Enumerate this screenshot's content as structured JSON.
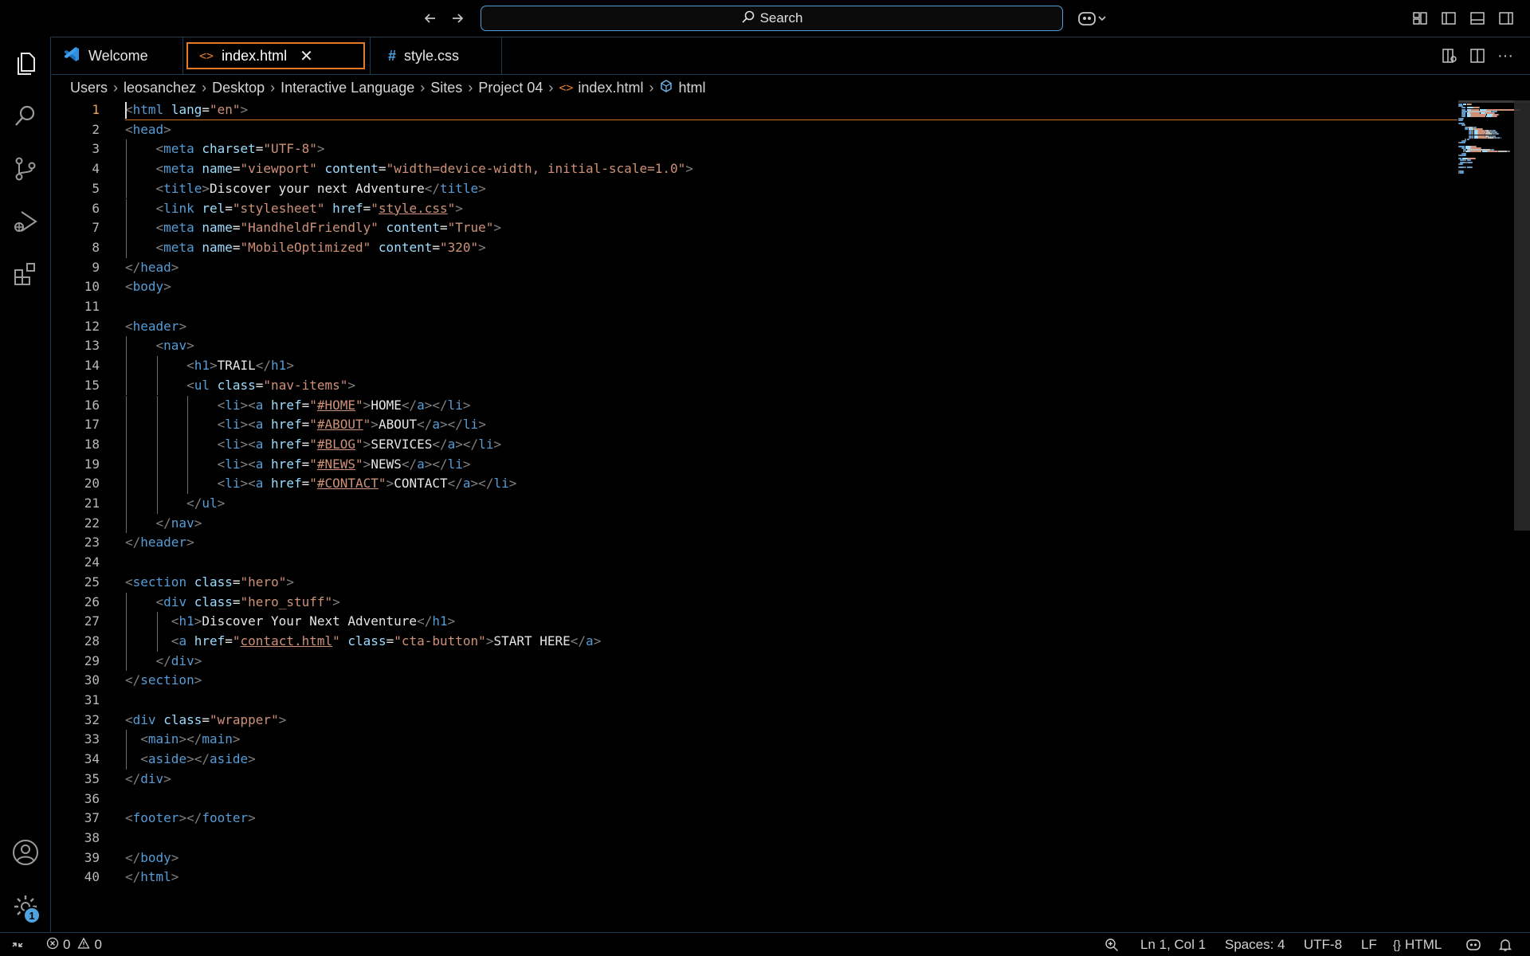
{
  "titlebar": {
    "search_label": "Search",
    "back_icon": "arrow-left-icon",
    "forward_icon": "arrow-right-icon"
  },
  "activity_bar": {
    "items": [
      "explorer",
      "search",
      "source-control",
      "run-and-debug",
      "extensions"
    ],
    "bottom": [
      "accounts",
      "manage"
    ],
    "manage_badge": "1"
  },
  "tabs": [
    {
      "label": "Welcome",
      "icon": "vscode-logo-icon",
      "active": false
    },
    {
      "label": "index.html",
      "icon": "html-file-icon",
      "active": true
    },
    {
      "label": "style.css",
      "icon": "css-file-icon",
      "active": false
    }
  ],
  "breadcrumb": [
    "Users",
    "leosanchez",
    "Desktop",
    "Interactive Language",
    "Sites",
    "Project 04",
    "index.html",
    "html"
  ],
  "editor": {
    "current_line": 1,
    "lines": [
      [
        [
          "br",
          "<"
        ],
        [
          "tag",
          "html"
        ],
        [
          "t",
          " "
        ],
        [
          "attr",
          "lang"
        ],
        [
          "t",
          "="
        ],
        [
          "str",
          "\"en\""
        ],
        [
          "br",
          ">"
        ]
      ],
      [
        [
          "br",
          "<"
        ],
        [
          "tag",
          "head"
        ],
        [
          "br",
          ">"
        ]
      ],
      [
        [
          "t",
          "    "
        ],
        [
          "br",
          "<"
        ],
        [
          "tag",
          "meta"
        ],
        [
          "t",
          " "
        ],
        [
          "attr",
          "charset"
        ],
        [
          "t",
          "="
        ],
        [
          "str",
          "\"UTF-8\""
        ],
        [
          "br",
          ">"
        ]
      ],
      [
        [
          "t",
          "    "
        ],
        [
          "br",
          "<"
        ],
        [
          "tag",
          "meta"
        ],
        [
          "t",
          " "
        ],
        [
          "attr",
          "name"
        ],
        [
          "t",
          "="
        ],
        [
          "str",
          "\"viewport\""
        ],
        [
          "t",
          " "
        ],
        [
          "attr",
          "content"
        ],
        [
          "t",
          "="
        ],
        [
          "str",
          "\"width=device-width, initial-scale=1.0\""
        ],
        [
          "br",
          ">"
        ]
      ],
      [
        [
          "t",
          "    "
        ],
        [
          "br",
          "<"
        ],
        [
          "tag",
          "title"
        ],
        [
          "br",
          ">"
        ],
        [
          "t",
          "Discover your next Adventure"
        ],
        [
          "br",
          "</"
        ],
        [
          "tag",
          "title"
        ],
        [
          "br",
          ">"
        ]
      ],
      [
        [
          "t",
          "    "
        ],
        [
          "br",
          "<"
        ],
        [
          "tag",
          "link"
        ],
        [
          "t",
          " "
        ],
        [
          "attr",
          "rel"
        ],
        [
          "t",
          "="
        ],
        [
          "str",
          "\"stylesheet\""
        ],
        [
          "t",
          " "
        ],
        [
          "attr",
          "href"
        ],
        [
          "t",
          "="
        ],
        [
          "str",
          "\""
        ],
        [
          "lnk",
          "style.css"
        ],
        [
          "str",
          "\""
        ],
        [
          "br",
          ">"
        ]
      ],
      [
        [
          "t",
          "    "
        ],
        [
          "br",
          "<"
        ],
        [
          "tag",
          "meta"
        ],
        [
          "t",
          " "
        ],
        [
          "attr",
          "name"
        ],
        [
          "t",
          "="
        ],
        [
          "str",
          "\"HandheldFriendly\""
        ],
        [
          "t",
          " "
        ],
        [
          "attr",
          "content"
        ],
        [
          "t",
          "="
        ],
        [
          "str",
          "\"True\""
        ],
        [
          "br",
          ">"
        ]
      ],
      [
        [
          "t",
          "    "
        ],
        [
          "br",
          "<"
        ],
        [
          "tag",
          "meta"
        ],
        [
          "t",
          " "
        ],
        [
          "attr",
          "name"
        ],
        [
          "t",
          "="
        ],
        [
          "str",
          "\"MobileOptimized\""
        ],
        [
          "t",
          " "
        ],
        [
          "attr",
          "content"
        ],
        [
          "t",
          "="
        ],
        [
          "str",
          "\"320\""
        ],
        [
          "br",
          ">"
        ]
      ],
      [
        [
          "br",
          "</"
        ],
        [
          "tag",
          "head"
        ],
        [
          "br",
          ">"
        ]
      ],
      [
        [
          "br",
          "<"
        ],
        [
          "tag",
          "body"
        ],
        [
          "br",
          ">"
        ]
      ],
      [],
      [
        [
          "br",
          "<"
        ],
        [
          "tag",
          "header"
        ],
        [
          "br",
          ">"
        ]
      ],
      [
        [
          "t",
          "    "
        ],
        [
          "br",
          "<"
        ],
        [
          "tag",
          "nav"
        ],
        [
          "br",
          ">"
        ]
      ],
      [
        [
          "t",
          "        "
        ],
        [
          "br",
          "<"
        ],
        [
          "tag",
          "h1"
        ],
        [
          "br",
          ">"
        ],
        [
          "t",
          "TRAIL"
        ],
        [
          "br",
          "</"
        ],
        [
          "tag",
          "h1"
        ],
        [
          "br",
          ">"
        ]
      ],
      [
        [
          "t",
          "        "
        ],
        [
          "br",
          "<"
        ],
        [
          "tag",
          "ul"
        ],
        [
          "t",
          " "
        ],
        [
          "attr",
          "class"
        ],
        [
          "t",
          "="
        ],
        [
          "str",
          "\"nav-items\""
        ],
        [
          "br",
          ">"
        ]
      ],
      [
        [
          "t",
          "            "
        ],
        [
          "br",
          "<"
        ],
        [
          "tag",
          "li"
        ],
        [
          "br",
          "><"
        ],
        [
          "tag",
          "a"
        ],
        [
          "t",
          " "
        ],
        [
          "attr",
          "href"
        ],
        [
          "t",
          "="
        ],
        [
          "str",
          "\""
        ],
        [
          "lnk",
          "#HOME"
        ],
        [
          "str",
          "\""
        ],
        [
          "br",
          ">"
        ],
        [
          "t",
          "HOME"
        ],
        [
          "br",
          "</"
        ],
        [
          "tag",
          "a"
        ],
        [
          "br",
          "></"
        ],
        [
          "tag",
          "li"
        ],
        [
          "br",
          ">"
        ]
      ],
      [
        [
          "t",
          "            "
        ],
        [
          "br",
          "<"
        ],
        [
          "tag",
          "li"
        ],
        [
          "br",
          "><"
        ],
        [
          "tag",
          "a"
        ],
        [
          "t",
          " "
        ],
        [
          "attr",
          "href"
        ],
        [
          "t",
          "="
        ],
        [
          "str",
          "\""
        ],
        [
          "lnk",
          "#ABOUT"
        ],
        [
          "str",
          "\""
        ],
        [
          "br",
          ">"
        ],
        [
          "t",
          "ABOUT"
        ],
        [
          "br",
          "</"
        ],
        [
          "tag",
          "a"
        ],
        [
          "br",
          "></"
        ],
        [
          "tag",
          "li"
        ],
        [
          "br",
          ">"
        ]
      ],
      [
        [
          "t",
          "            "
        ],
        [
          "br",
          "<"
        ],
        [
          "tag",
          "li"
        ],
        [
          "br",
          "><"
        ],
        [
          "tag",
          "a"
        ],
        [
          "t",
          " "
        ],
        [
          "attr",
          "href"
        ],
        [
          "t",
          "="
        ],
        [
          "str",
          "\""
        ],
        [
          "lnk",
          "#BLOG"
        ],
        [
          "str",
          "\""
        ],
        [
          "br",
          ">"
        ],
        [
          "t",
          "SERVICES"
        ],
        [
          "br",
          "</"
        ],
        [
          "tag",
          "a"
        ],
        [
          "br",
          "></"
        ],
        [
          "tag",
          "li"
        ],
        [
          "br",
          ">"
        ]
      ],
      [
        [
          "t",
          "            "
        ],
        [
          "br",
          "<"
        ],
        [
          "tag",
          "li"
        ],
        [
          "br",
          "><"
        ],
        [
          "tag",
          "a"
        ],
        [
          "t",
          " "
        ],
        [
          "attr",
          "href"
        ],
        [
          "t",
          "="
        ],
        [
          "str",
          "\""
        ],
        [
          "lnk",
          "#NEWS"
        ],
        [
          "str",
          "\""
        ],
        [
          "br",
          ">"
        ],
        [
          "t",
          "NEWS"
        ],
        [
          "br",
          "</"
        ],
        [
          "tag",
          "a"
        ],
        [
          "br",
          "></"
        ],
        [
          "tag",
          "li"
        ],
        [
          "br",
          ">"
        ]
      ],
      [
        [
          "t",
          "            "
        ],
        [
          "br",
          "<"
        ],
        [
          "tag",
          "li"
        ],
        [
          "br",
          "><"
        ],
        [
          "tag",
          "a"
        ],
        [
          "t",
          " "
        ],
        [
          "attr",
          "href"
        ],
        [
          "t",
          "="
        ],
        [
          "str",
          "\""
        ],
        [
          "lnk",
          "#CONTACT"
        ],
        [
          "str",
          "\""
        ],
        [
          "br",
          ">"
        ],
        [
          "t",
          "CONTACT"
        ],
        [
          "br",
          "</"
        ],
        [
          "tag",
          "a"
        ],
        [
          "br",
          "></"
        ],
        [
          "tag",
          "li"
        ],
        [
          "br",
          ">"
        ]
      ],
      [
        [
          "t",
          "        "
        ],
        [
          "br",
          "</"
        ],
        [
          "tag",
          "ul"
        ],
        [
          "br",
          ">"
        ]
      ],
      [
        [
          "t",
          "    "
        ],
        [
          "br",
          "</"
        ],
        [
          "tag",
          "nav"
        ],
        [
          "br",
          ">"
        ]
      ],
      [
        [
          "br",
          "</"
        ],
        [
          "tag",
          "header"
        ],
        [
          "br",
          ">"
        ]
      ],
      [],
      [
        [
          "br",
          "<"
        ],
        [
          "tag",
          "section"
        ],
        [
          "t",
          " "
        ],
        [
          "attr",
          "class"
        ],
        [
          "t",
          "="
        ],
        [
          "str",
          "\"hero\""
        ],
        [
          "br",
          ">"
        ]
      ],
      [
        [
          "t",
          "    "
        ],
        [
          "br",
          "<"
        ],
        [
          "tag",
          "div"
        ],
        [
          "t",
          " "
        ],
        [
          "attr",
          "class"
        ],
        [
          "t",
          "="
        ],
        [
          "str",
          "\"hero_stuff\""
        ],
        [
          "br",
          ">"
        ]
      ],
      [
        [
          "t",
          "      "
        ],
        [
          "br",
          "<"
        ],
        [
          "tag",
          "h1"
        ],
        [
          "br",
          ">"
        ],
        [
          "t",
          "Discover Your Next Adventure"
        ],
        [
          "br",
          "</"
        ],
        [
          "tag",
          "h1"
        ],
        [
          "br",
          ">"
        ]
      ],
      [
        [
          "t",
          "      "
        ],
        [
          "br",
          "<"
        ],
        [
          "tag",
          "a"
        ],
        [
          "t",
          " "
        ],
        [
          "attr",
          "href"
        ],
        [
          "t",
          "="
        ],
        [
          "str",
          "\""
        ],
        [
          "lnk",
          "contact.html"
        ],
        [
          "str",
          "\""
        ],
        [
          "t",
          " "
        ],
        [
          "attr",
          "class"
        ],
        [
          "t",
          "="
        ],
        [
          "str",
          "\"cta-button\""
        ],
        [
          "br",
          ">"
        ],
        [
          "t",
          "START HERE"
        ],
        [
          "br",
          "</"
        ],
        [
          "tag",
          "a"
        ],
        [
          "br",
          ">"
        ]
      ],
      [
        [
          "t",
          "    "
        ],
        [
          "br",
          "</"
        ],
        [
          "tag",
          "div"
        ],
        [
          "br",
          ">"
        ]
      ],
      [
        [
          "br",
          "</"
        ],
        [
          "tag",
          "section"
        ],
        [
          "br",
          ">"
        ]
      ],
      [],
      [
        [
          "br",
          "<"
        ],
        [
          "tag",
          "div"
        ],
        [
          "t",
          " "
        ],
        [
          "attr",
          "class"
        ],
        [
          "t",
          "="
        ],
        [
          "str",
          "\"wrapper\""
        ],
        [
          "br",
          ">"
        ]
      ],
      [
        [
          "t",
          "  "
        ],
        [
          "br",
          "<"
        ],
        [
          "tag",
          "main"
        ],
        [
          "br",
          "></"
        ],
        [
          "tag",
          "main"
        ],
        [
          "br",
          ">"
        ]
      ],
      [
        [
          "t",
          "  "
        ],
        [
          "br",
          "<"
        ],
        [
          "tag",
          "aside"
        ],
        [
          "br",
          "></"
        ],
        [
          "tag",
          "aside"
        ],
        [
          "br",
          ">"
        ]
      ],
      [
        [
          "br",
          "</"
        ],
        [
          "tag",
          "div"
        ],
        [
          "br",
          ">"
        ]
      ],
      [],
      [
        [
          "br",
          "<"
        ],
        [
          "tag",
          "footer"
        ],
        [
          "br",
          "></"
        ],
        [
          "tag",
          "footer"
        ],
        [
          "br",
          ">"
        ]
      ],
      [],
      [
        [
          "br",
          "</"
        ],
        [
          "tag",
          "body"
        ],
        [
          "br",
          ">"
        ]
      ],
      [
        [
          "br",
          "</"
        ],
        [
          "tag",
          "html"
        ],
        [
          "br",
          ">"
        ]
      ]
    ]
  },
  "statusbar": {
    "errors": "0",
    "warnings": "0",
    "cursor_position": "Ln 1, Col 1",
    "indentation": "Spaces: 4",
    "encoding": "UTF-8",
    "eol": "LF",
    "language": "HTML"
  },
  "colors": {
    "tag": "#569cd6",
    "attribute": "#9cdcfe",
    "string": "#ce9178",
    "accent_orange": "#e07b2b",
    "focus_blue": "#4f9fd6"
  }
}
